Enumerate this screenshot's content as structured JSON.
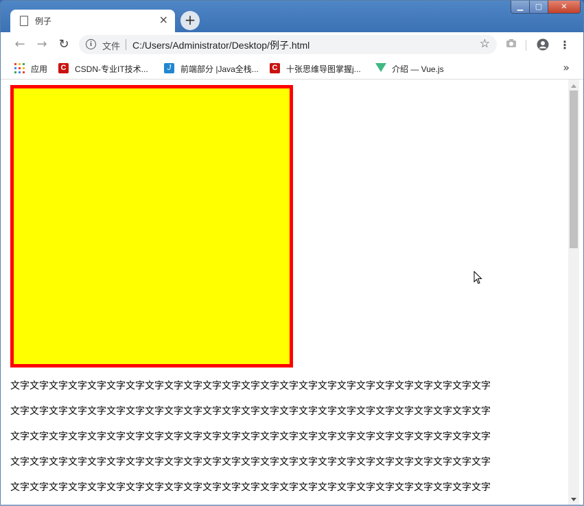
{
  "tab": {
    "title": "例子",
    "close": "×"
  },
  "newtab": "+",
  "window_controls": {
    "minimize": "▁",
    "maximize": "▢",
    "close": "✕"
  },
  "toolbar": {
    "back": "←",
    "forward": "→",
    "reload": "↻",
    "scheme_label": "文件",
    "url": "C:/Users/Administrator/Desktop/例子.html",
    "star": "☆",
    "camera": "📷",
    "account": "●",
    "menu": "⋮"
  },
  "bookmarks": {
    "items": [
      {
        "label": "应用",
        "icon": "apps-grid"
      },
      {
        "label": "CSDN-专业IT技术...",
        "icon": "csdn",
        "glyph": "C"
      },
      {
        "label": "前端部分 |Java全栈...",
        "icon": "j",
        "glyph": "J"
      },
      {
        "label": "十张思维导图掌握j...",
        "icon": "csdn",
        "glyph": "C"
      },
      {
        "label": "介绍 — Vue.js",
        "icon": "vue"
      }
    ],
    "more": "»"
  },
  "content": {
    "box": {
      "background": "#ffff00",
      "border": "#ff0000"
    },
    "lines": [
      "文字文字文字文字文字文字文字文字文字文字文字文字文字文字文字文字文字文字文字文字文字文字文字文字文字",
      "文字文字文字文字文字文字文字文字文字文字文字文字文字文字文字文字文字文字文字文字文字文字文字文字文字",
      "文字文字文字文字文字文字文字文字文字文字文字文字文字文字文字文字文字文字文字文字文字文字文字文字文字",
      "文字文字文字文字文字文字文字文字文字文字文字文字文字文字文字文字文字文字文字文字文字文字文字文字文字",
      "文字文字文字文字文字文字文字文字文字文字文字文字文字文字文字文字文字文字文字文字文字文字文字文字文字"
    ]
  }
}
